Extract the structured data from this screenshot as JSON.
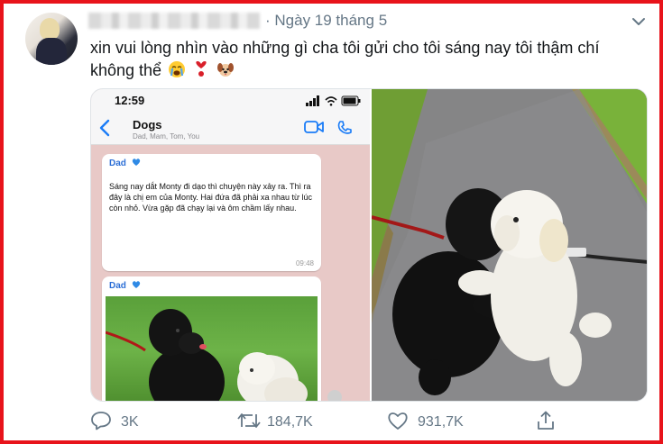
{
  "tweet": {
    "date": "· Ngày 19 tháng 5",
    "text_line1": "xin vui lòng nhìn vào những gì cha tôi gửi cho tôi sáng nay tôi thậm chí",
    "text_line2": "không thể"
  },
  "phone": {
    "time": "12:59",
    "group_name": "Dogs",
    "group_members": "Dad, Mam, Tom, You",
    "message1": {
      "sender": "Dad",
      "text": "Sáng nay dắt Monty đi dạo thì chuyện này xảy ra. Thì ra đây là chị em của Monty. Hai đứa đã phải xa nhau từ lúc còn nhỏ. Vừa gặp đã chạy lại và ôm chầm lấy nhau.",
      "time": "09:48"
    },
    "message2": {
      "sender": "Dad"
    }
  },
  "actions": {
    "reply_count": "3K",
    "retweet_count": "184,7K",
    "like_count": "931,7K"
  },
  "colors": {
    "frame": "#e8131b",
    "muted": "#657786",
    "ios_blue": "#1a7cf7"
  }
}
